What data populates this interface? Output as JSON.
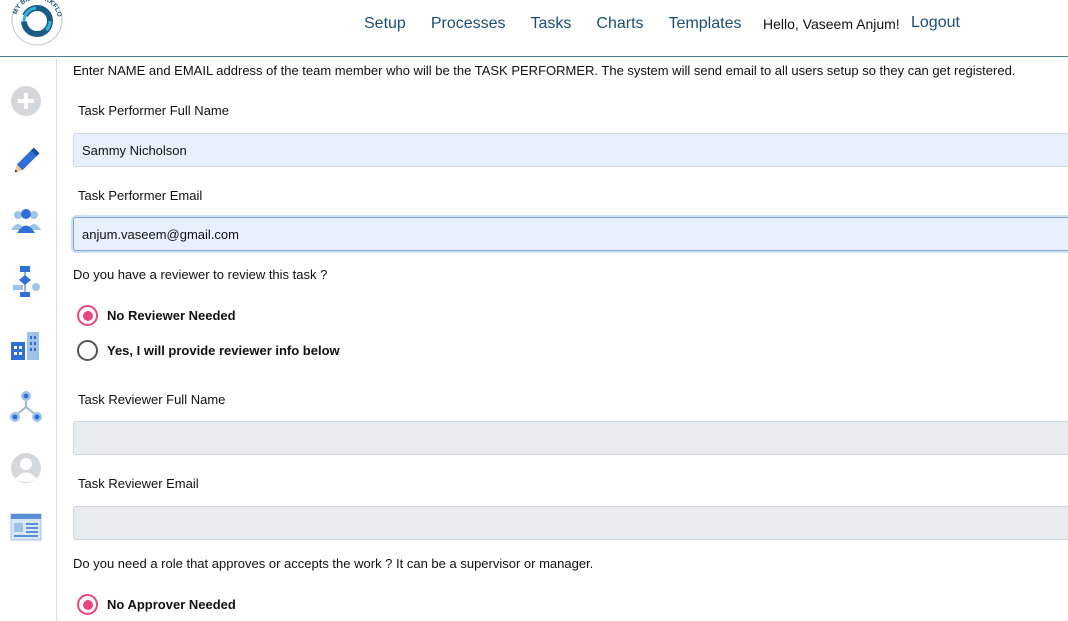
{
  "header": {
    "logo_text": "MY BIZ WORKFLOW",
    "nav": [
      "Setup",
      "Processes",
      "Tasks",
      "Charts",
      "Templates"
    ],
    "greeting": "Hello,  Vaseem Anjum!",
    "logout": "Logout"
  },
  "sidebar": {
    "icons": [
      "plus-circle-icon",
      "pencil-icon",
      "team-icon",
      "workflow-icon",
      "building-icon",
      "network-icon",
      "user-avatar-icon",
      "template-list-icon"
    ]
  },
  "form": {
    "intro": "Enter NAME and EMAIL address of the team member who will be the TASK PERFORMER. The system will send email to all users setup so they can get registered.",
    "performer_name_label": "Task Performer Full Name",
    "performer_name_value": "Sammy Nicholson",
    "performer_email_label": "Task Performer Email",
    "performer_email_value": "anjum.vaseem@gmail.com",
    "reviewer_question": "Do you have a reviewer to review this task ?",
    "reviewer_options": [
      "No Reviewer Needed",
      "Yes, I will provide reviewer info below"
    ],
    "reviewer_name_label": "Task Reviewer Full Name",
    "reviewer_name_value": "",
    "reviewer_email_label": "Task Reviewer Email",
    "reviewer_email_value": "",
    "approver_question": "Do you need a role that approves or accepts the work ? It can be a supervisor or manager.",
    "approver_options": [
      "No Approver Needed"
    ]
  },
  "colors": {
    "nav_link": "#1d4f73",
    "radio_checked": "#e8467c",
    "input_filled_bg": "#e8f0fe",
    "input_disabled_bg": "#e9ecef"
  }
}
